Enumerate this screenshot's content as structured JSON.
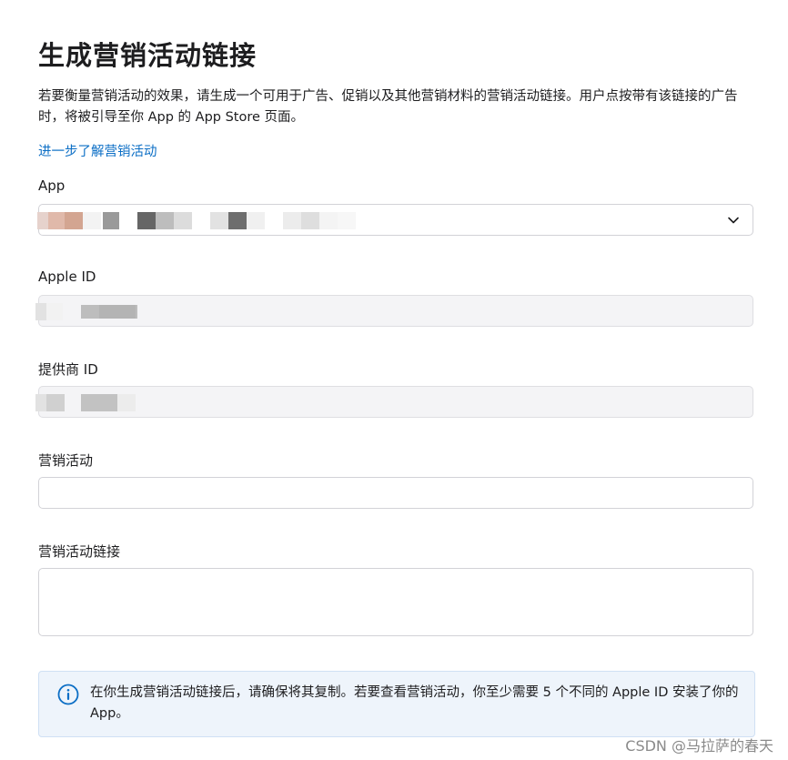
{
  "title": "生成营销活动链接",
  "description": "若要衡量营销活动的效果，请生成一个可用于广告、促销以及其他营销材料的营销活动链接。用户点按带有该链接的广告时，将被引导至你 App 的 App Store 页面。",
  "learn_more": "进一步了解营销活动",
  "fields": {
    "app": {
      "label": "App",
      "value": ""
    },
    "apple_id": {
      "label": "Apple ID",
      "value": ""
    },
    "provider_id": {
      "label": "提供商 ID",
      "value": ""
    },
    "campaign": {
      "label": "营销活动",
      "value": ""
    },
    "campaign_link": {
      "label": "营销活动链接",
      "value": ""
    }
  },
  "info": {
    "icon": "info-icon",
    "text": "在你生成营销活动链接后，请确保将其复制。若要查看营销活动，你至少需要 5 个不同的 Apple ID 安装了你的 App。"
  },
  "watermark": "CSDN @马拉萨的春天",
  "colors": {
    "link": "#0b6ec5",
    "info_icon": "#0b6ec5",
    "info_bg": "#eef4fb"
  }
}
